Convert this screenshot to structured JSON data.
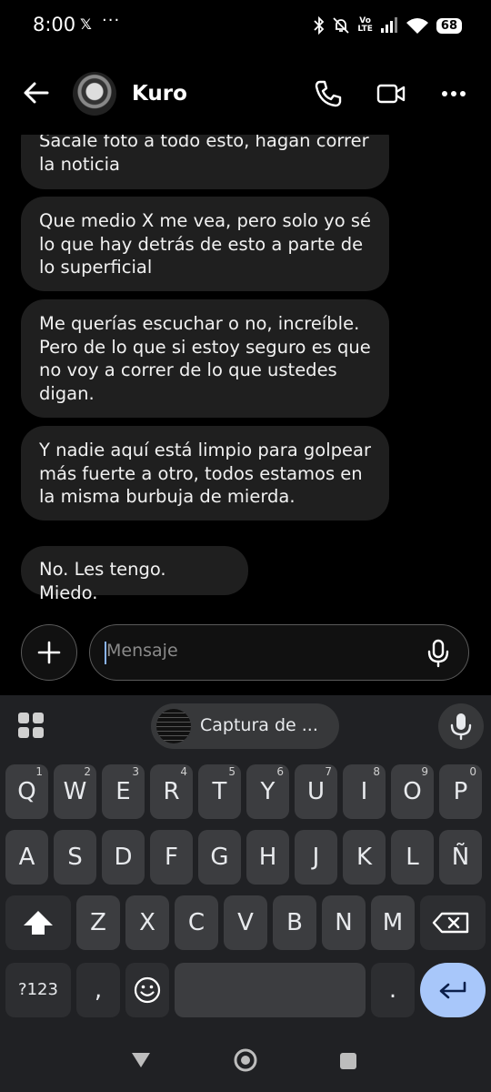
{
  "status_bar": {
    "time": "8:00",
    "notif_x": "𝕏",
    "more": "···",
    "volte_top": "Vo",
    "volte_bottom": "LTE",
    "battery": "68"
  },
  "header": {
    "contact_name": "Kuro"
  },
  "messages": [
    "Sacale foto a todo esto, hagan correr la noticia",
    "Que medio X me vea, pero solo yo sé lo que hay detrás de esto a parte de lo superficial",
    "Me querías escuchar o no, increíble. Pero de lo que si estoy seguro es que no voy a correr de lo que ustedes digan.",
    "Y nadie aquí está limpio para golpear más fuerte a otro, todos estamos en la misma burbuja de mierda.",
    "No. Les tengo. Miedo."
  ],
  "composer": {
    "placeholder": "Mensaje"
  },
  "keyboard": {
    "suggestion_chip": "Captura de ...",
    "row1": [
      {
        "k": "Q",
        "h": "1"
      },
      {
        "k": "W",
        "h": "2"
      },
      {
        "k": "E",
        "h": "3"
      },
      {
        "k": "R",
        "h": "4"
      },
      {
        "k": "T",
        "h": "5"
      },
      {
        "k": "Y",
        "h": "6"
      },
      {
        "k": "U",
        "h": "7"
      },
      {
        "k": "I",
        "h": "8"
      },
      {
        "k": "O",
        "h": "9"
      },
      {
        "k": "P",
        "h": "0"
      }
    ],
    "row2": [
      "A",
      "S",
      "D",
      "F",
      "G",
      "H",
      "J",
      "K",
      "L",
      "Ñ"
    ],
    "row3": [
      "Z",
      "X",
      "C",
      "V",
      "B",
      "N",
      "M"
    ],
    "symbols_label": "?123",
    "comma": ",",
    "period": "."
  },
  "colors": {
    "bubble": "#1f1f1f",
    "keyboard_bg": "#202124",
    "key": "#3c3d40",
    "enter": "#a8c7fa"
  }
}
